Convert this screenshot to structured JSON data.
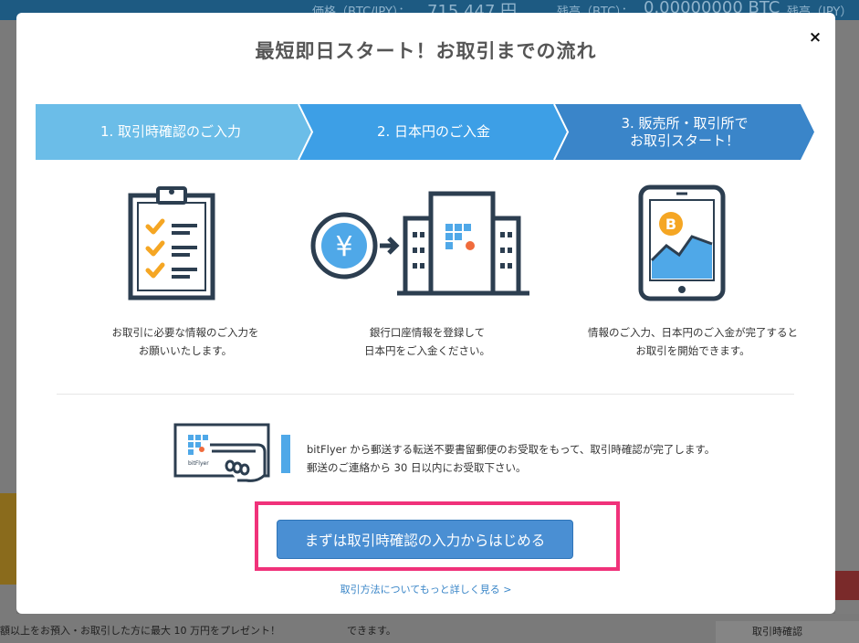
{
  "background": {
    "price_label": "価格（BTC/JPY）：",
    "price_value": "715,447 円",
    "btc_label": "残高（BTC）：",
    "btc_value": "0.00000000 BTC",
    "jpy_label": "残高（JPY）",
    "bottom_left_text": "額以上をお預入・お取引した方に最大 10 万円をプレゼント！",
    "bottom_mid_text": "できます。",
    "bottom_right_text": "取引時確認"
  },
  "modal": {
    "title": "最短即日スタート！お取引までの流れ",
    "close_label": "×",
    "steps": [
      {
        "label": "1. 取引時確認のご入力"
      },
      {
        "label": "2. 日本円のご入金"
      },
      {
        "label": "3. 販売所・取引所で\nお取引スタート！"
      }
    ],
    "descriptions": [
      "お取引に必要な情報のご入力を\nお願いいたします。",
      "銀行口座情報を登録して\n日本円をご入金ください。",
      "情報のご入力、日本円のご入金が完了すると\nお取引を開始できます。"
    ],
    "yen_symbol": "¥",
    "coin_symbol": "B",
    "card_brand": "bitFlyer",
    "mail_text": "bitFlyer から郵送する転送不要書留郵便のお受取をもって、取引時確認が完了します。\n郵送のご連絡から 30 日以内にお受取下さい。",
    "cta_label": "まずは取引時確認の入力からはじめる",
    "more_link": "取引方法についてもっと詳しく見る >"
  },
  "colors": {
    "step1": "#6bbde8",
    "step2": "#3d9fe6",
    "step3": "#3a85c9",
    "cta": "#4a8fd3",
    "highlight": "#f0327a",
    "icon_dark": "#2c3e50",
    "icon_orange": "#f5a623",
    "icon_blue": "#4fa8e8"
  }
}
